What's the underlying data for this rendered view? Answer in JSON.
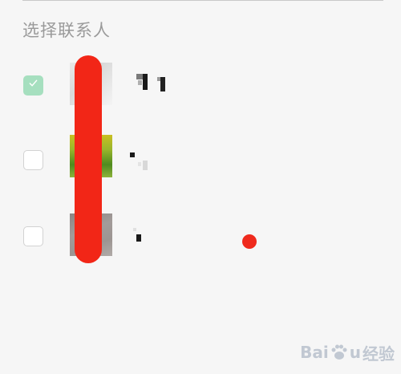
{
  "header": {
    "title": "选择联系人"
  },
  "contacts": [
    {
      "checked": true,
      "avatar_color": "#dcdcdc"
    },
    {
      "checked": false,
      "avatar_color": "#7aa42b"
    },
    {
      "checked": false,
      "avatar_color": "#9c9592"
    }
  ],
  "annotation": {
    "redaction_color": "#f22617",
    "dot_color": "#ef2a1d"
  },
  "watermark": {
    "text_latin_a": "Bai",
    "text_latin_b": "u",
    "text_cn": "经验"
  },
  "colors": {
    "checkbox_checked": "#a6dfbf",
    "background": "#f6f6f6",
    "title_text": "#9a9a9a"
  }
}
